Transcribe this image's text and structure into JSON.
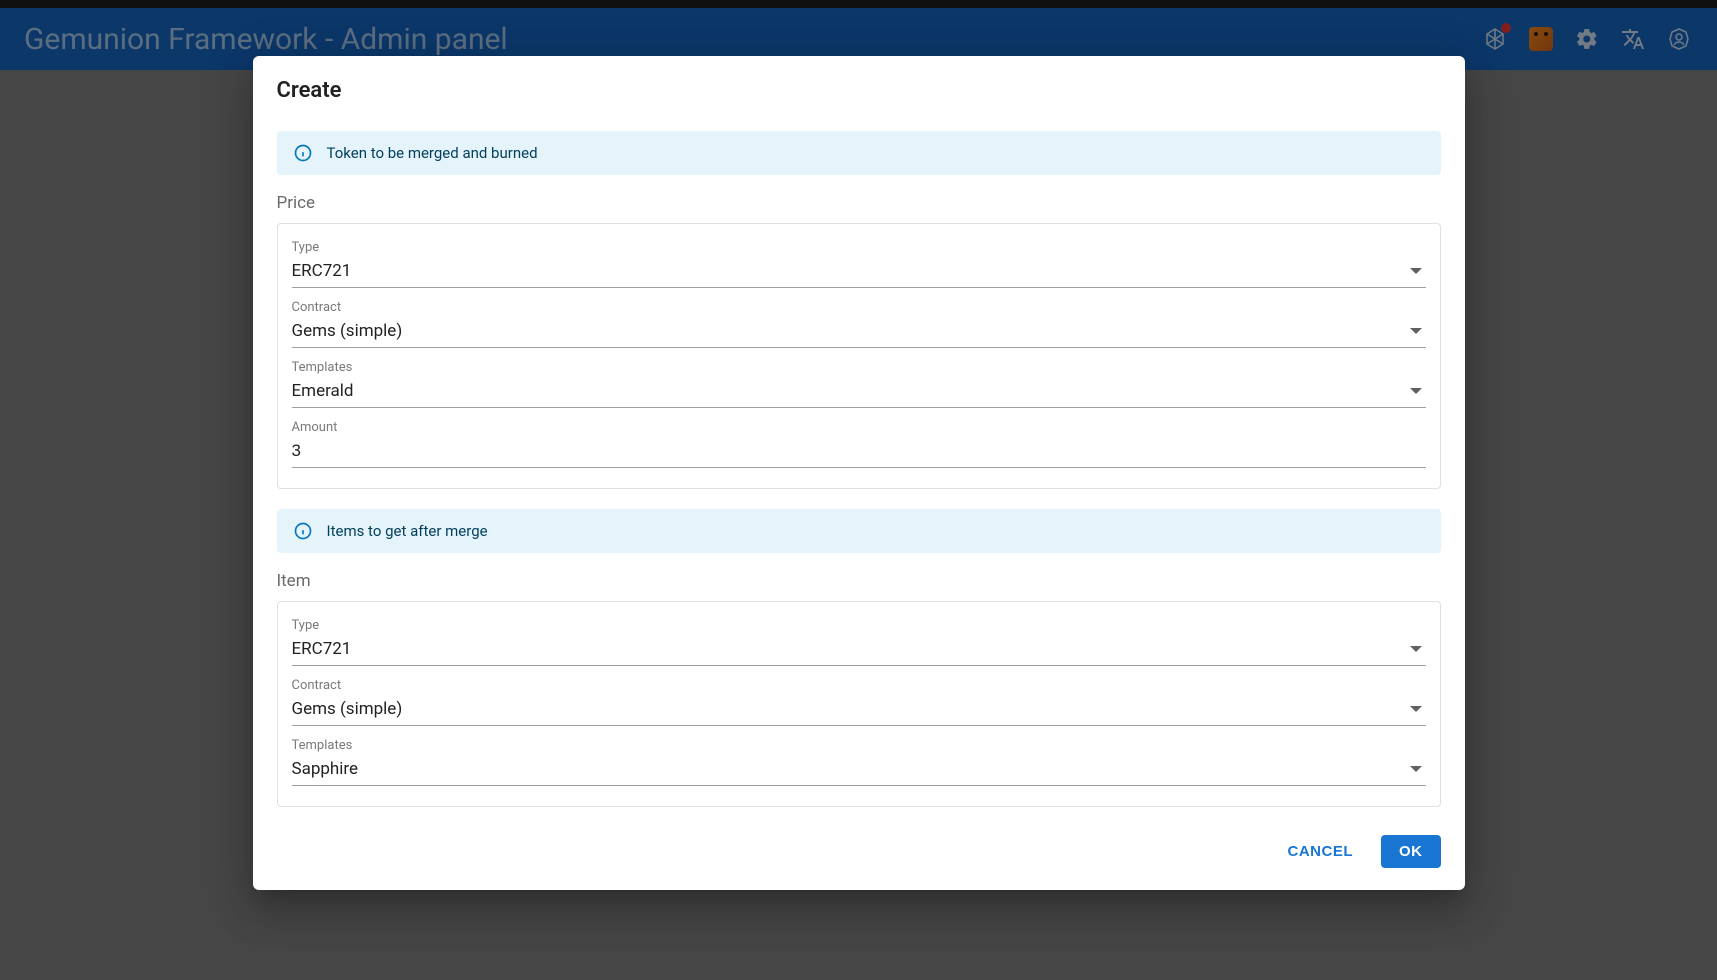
{
  "appbar": {
    "title": "Gemunion Framework - Admin panel"
  },
  "dialog": {
    "title": "Create",
    "alert_price": "Token to be merged and burned",
    "alert_item": "Items to get after merge",
    "price_section_label": "Price",
    "item_section_label": "Item",
    "price": {
      "type_label": "Type",
      "type_value": "ERC721",
      "contract_label": "Contract",
      "contract_value": "Gems (simple)",
      "templates_label": "Templates",
      "templates_value": "Emerald",
      "amount_label": "Amount",
      "amount_value": "3"
    },
    "item": {
      "type_label": "Type",
      "type_value": "ERC721",
      "contract_label": "Contract",
      "contract_value": "Gems (simple)",
      "templates_label": "Templates",
      "templates_value": "Sapphire"
    },
    "actions": {
      "cancel": "CANCEL",
      "ok": "OK"
    }
  }
}
